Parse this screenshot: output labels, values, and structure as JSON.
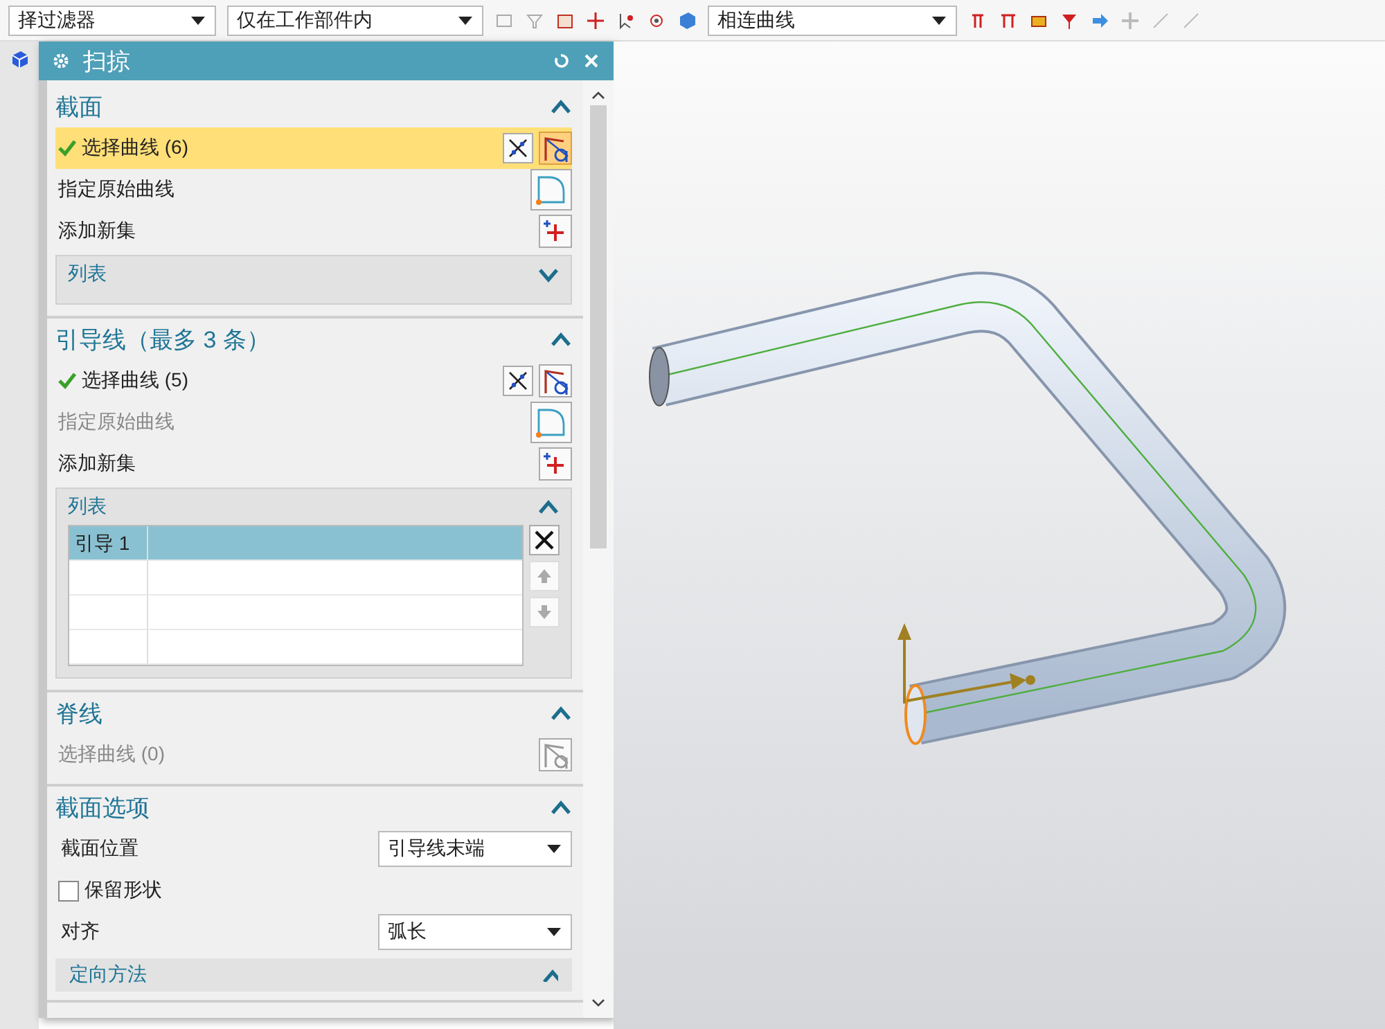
{
  "toolbar": {
    "filter": "择过滤器",
    "scope": "仅在工作部件内",
    "curve_rule": "相连曲线"
  },
  "dialog": {
    "title": "扫掠"
  },
  "sections": [
    {
      "title": "截面",
      "expanded": true,
      "items": [
        {
          "kind": "select",
          "label": "选择曲线 (6)",
          "done": true,
          "active": true,
          "disabled": false,
          "reverse_button": true
        },
        {
          "kind": "origin",
          "label": "指定原始曲线",
          "disabled": false
        },
        {
          "kind": "add",
          "label": "添加新集"
        },
        {
          "kind": "list",
          "title": "列表",
          "expanded": false
        }
      ]
    },
    {
      "title": "引导线（最多 3 条）",
      "expanded": true,
      "items": [
        {
          "kind": "select",
          "label": "选择曲线 (5)",
          "done": true,
          "active": false,
          "disabled": false,
          "reverse_button": true
        },
        {
          "kind": "origin",
          "label": "指定原始曲线",
          "disabled": true
        },
        {
          "kind": "add",
          "label": "添加新集"
        },
        {
          "kind": "list",
          "title": "列表",
          "expanded": true,
          "rows": [
            {
              "label": "引导 1",
              "selected": true
            }
          ]
        }
      ]
    },
    {
      "title": "脊线",
      "expanded": true,
      "items": [
        {
          "kind": "select",
          "label": "选择曲线 (0)",
          "done": false,
          "active": false,
          "disabled": true,
          "reverse_button": false
        }
      ]
    },
    {
      "title": "截面选项",
      "expanded": true,
      "items": [
        {
          "kind": "dropdown",
          "label": "截面位置",
          "value": "引导线末端"
        },
        {
          "kind": "checkbox",
          "label": "保留形状",
          "checked": false
        },
        {
          "kind": "dropdown",
          "label": "对齐",
          "value": "弧长"
        },
        {
          "kind": "subheader",
          "title": "定向方法",
          "expanded": true
        }
      ]
    }
  ]
}
